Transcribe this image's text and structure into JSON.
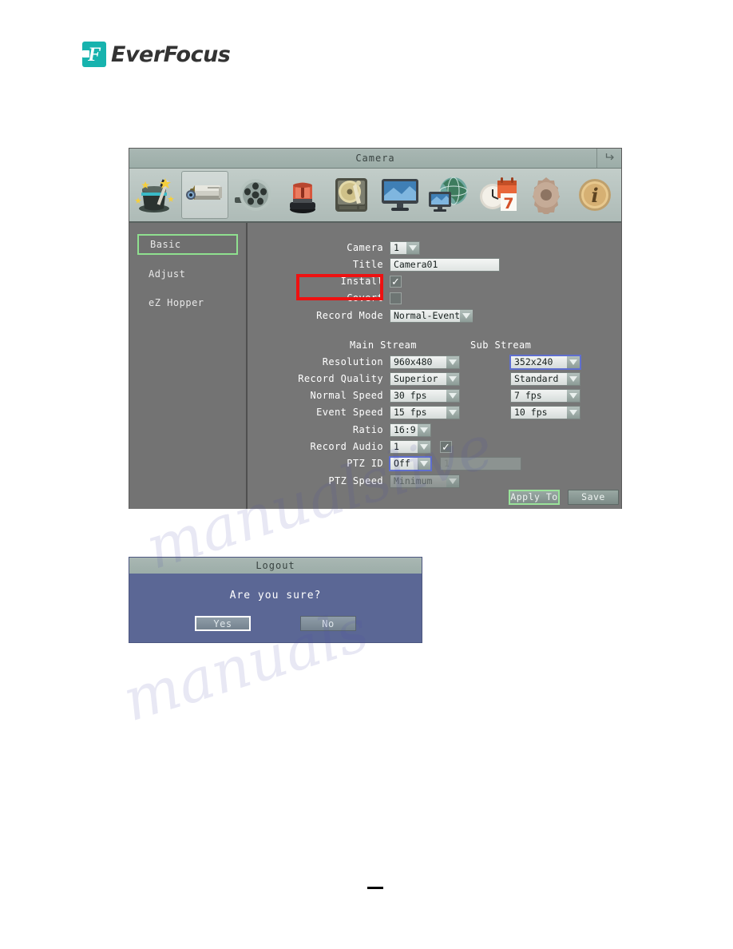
{
  "brand": {
    "name": "EverFocus",
    "mark_letter": "F",
    "accent_color": "#17b3ae"
  },
  "watermark": {
    "line1": "manualslive",
    "line2": "manuals"
  },
  "dvr": {
    "title": "Camera",
    "back_icon": "back-arrow-icon",
    "toolbar": [
      {
        "name": "wizard",
        "icon": "magic-hat-icon",
        "active": false
      },
      {
        "name": "camera",
        "icon": "camera-icon",
        "active": true
      },
      {
        "name": "record",
        "icon": "film-reel-icon",
        "active": false
      },
      {
        "name": "alarm",
        "icon": "alarm-siren-icon",
        "active": false
      },
      {
        "name": "disk",
        "icon": "hard-disk-icon",
        "active": false
      },
      {
        "name": "display",
        "icon": "monitor-icon",
        "active": false
      },
      {
        "name": "network",
        "icon": "network-globe-icon",
        "active": false
      },
      {
        "name": "schedule",
        "icon": "clock-calendar-icon",
        "active": false
      },
      {
        "name": "system",
        "icon": "gear-icon",
        "active": false
      },
      {
        "name": "information",
        "icon": "info-icon",
        "active": false
      }
    ],
    "sidebar": [
      {
        "label": "Basic",
        "selected": true
      },
      {
        "label": "Adjust",
        "selected": false
      },
      {
        "label": "eZ Hopper",
        "selected": false
      }
    ],
    "form": {
      "camera_label": "Camera",
      "camera_value": "1",
      "title_label": "Title",
      "title_value": "Camera01",
      "install_label": "Install",
      "install_checked": true,
      "covert_label": "Covert",
      "covert_checked": false,
      "record_mode_label": "Record Mode",
      "record_mode_value": "Normal-Event"
    },
    "stream": {
      "main_header": "Main Stream",
      "sub_header": "Sub Stream",
      "rows": [
        {
          "label": "Resolution",
          "main": "960x480",
          "sub": "352x240"
        },
        {
          "label": "Record Quality",
          "main": "Superior",
          "sub": "Standard"
        },
        {
          "label": "Normal Speed",
          "main": "30 fps",
          "sub": "7 fps"
        },
        {
          "label": "Event Speed",
          "main": "15 fps",
          "sub": "10 fps"
        }
      ]
    },
    "ptz": {
      "ratio_label": "Ratio",
      "ratio_value": "16:9",
      "record_audio_label": "Record Audio",
      "record_audio_value": "1",
      "record_audio_checked": true,
      "ptz_id_label": "PTZ ID",
      "ptz_id_value": "Off",
      "ptz_id_field_value": "1",
      "ptz_speed_label": "PTZ Speed",
      "ptz_speed_value": "Minimum"
    },
    "buttons": {
      "apply_to": "Apply To",
      "save": "Save"
    }
  },
  "logout": {
    "title": "Logout",
    "message": "Are you sure?",
    "yes": "Yes",
    "no": "No"
  }
}
